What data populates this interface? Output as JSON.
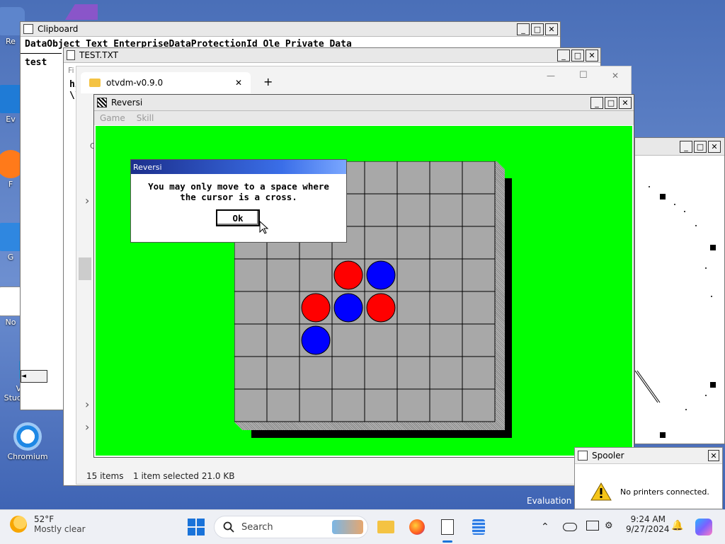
{
  "clipboard": {
    "title": "Clipboard",
    "content_header": "DataObject  Text   EnterpriseDataProtectionId  Ole Private Data",
    "content": "test",
    "minimize": "_",
    "maximize": "□",
    "close": "✕"
  },
  "testtxt": {
    "title": "TEST.TXT",
    "menu_partial": "Fi",
    "line1": "hi",
    "line2": "\\\\",
    "minimize": "_",
    "maximize": "□",
    "close": "✕"
  },
  "explorer": {
    "tab_title": "otvdm-v0.9.0",
    "tab_close": "✕",
    "new_tab": "+",
    "minimize": "—",
    "maximize": "☐",
    "close": "✕",
    "status_items": "15 items",
    "status_selected": "1 item selected  21.0 KB",
    "chev1": "›",
    "chev2": "›",
    "chev3": "›",
    "col_c": "C"
  },
  "reversi": {
    "title": "Reversi",
    "menu": [
      "Game",
      "Skill"
    ],
    "minimize": "_",
    "maximize": "□",
    "close": "✕",
    "board_size": 8,
    "pieces": [
      {
        "row": 3,
        "col": 3,
        "color": "#ff0000"
      },
      {
        "row": 3,
        "col": 4,
        "color": "#0000ff"
      },
      {
        "row": 4,
        "col": 2,
        "color": "#ff0000"
      },
      {
        "row": 4,
        "col": 3,
        "color": "#0000ff"
      },
      {
        "row": 4,
        "col": 4,
        "color": "#ff0000"
      },
      {
        "row": 5,
        "col": 2,
        "color": "#0000ff"
      }
    ],
    "bg_color": "#00ff00"
  },
  "dialog": {
    "title": "Reversi",
    "message_line1": "You may only move to a space where",
    "message_line2": "the cursor is a cross.",
    "ok_label": "Ok"
  },
  "rightwin": {
    "minimize": "_",
    "maximize": "□",
    "close": "✕"
  },
  "spooler": {
    "title": "Spooler",
    "close": "✕",
    "message": "No printers connected."
  },
  "desktop": {
    "icons": [
      {
        "label": "Re",
        "glyph": "#3a6dc9"
      },
      {
        "label": "Ev",
        "glyph": "#1f7bd6"
      },
      {
        "label": "F",
        "glyph": "#ff7a1a"
      },
      {
        "label": "G",
        "glyph": "#2f87e0"
      },
      {
        "label": "No",
        "glyph": "#ffffff"
      },
      {
        "label": "Visual Studio Code",
        "glyph": "#1c8ad8"
      },
      {
        "label": "Chromium",
        "glyph": "#1e88e5"
      }
    ],
    "watermark": "Evaluation co"
  },
  "taskbar": {
    "weather_temp": "52°F",
    "weather_desc": "Mostly clear",
    "search_placeholder": "Search",
    "time": "9:24 AM",
    "date": "9/27/2024",
    "chevron": "^"
  }
}
